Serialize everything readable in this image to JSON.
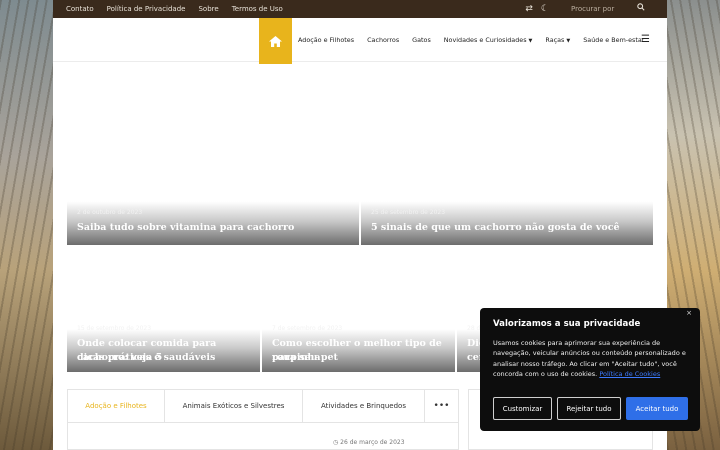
{
  "topbar": {
    "links": [
      "Contato",
      "Política de Privacidade",
      "Sobre",
      "Termos de Uso"
    ],
    "search_placeholder": "Procurar por",
    "icons": [
      "shuffle-icon",
      "moon-icon",
      "search-icon"
    ]
  },
  "nav": {
    "home_icon": "home-icon",
    "items": [
      {
        "label": "Adoção e Filhotes",
        "dropdown": false
      },
      {
        "label": "Cachorros",
        "dropdown": false
      },
      {
        "label": "Gatos",
        "dropdown": false
      },
      {
        "label": "Novidades e Curiosidades",
        "dropdown": true
      },
      {
        "label": "Raças",
        "dropdown": true
      },
      {
        "label": "Saúde e Bem-estar",
        "dropdown": false
      }
    ],
    "menu_icon": "hamburger-icon"
  },
  "posts": [
    {
      "date": "2 de outubro de 2023",
      "title": "Saiba tudo sobre vitamina para cachorro"
    },
    {
      "date": "25 de setembro de 2023",
      "title": "5 sinais de que um cachorro não gosta de você"
    },
    {
      "date": "15 de setembro de 2023",
      "title_line1": "Onde colocar comida para cachorro: veja 5",
      "title_line2": "dicas práticas e saudáveis"
    },
    {
      "date": "7 de setembro de 2023",
      "title_line1": "Como escolher o melhor tipo de roupinha",
      "title_line2": "para seu pet"
    },
    {
      "date": "28 d",
      "title_line1": "Dic",
      "title_line2": "cer"
    }
  ],
  "tabs": {
    "items": [
      "Adoção e Filhotes",
      "Animais Exóticos e Silvestres",
      "Atividades e Brinquedos"
    ],
    "more_label": "•••",
    "active_index": 0
  },
  "panel": {
    "date": "26 de março de 2023"
  },
  "cookie": {
    "title": "Valorizamos a sua privacidade",
    "text": "Usamos cookies para aprimorar sua experiência de navegação, veicular anúncios ou conteúdo personalizado e analisar nosso tráfego. Ao clicar em \"Aceitar tudo\", você concorda com o uso de cookies.",
    "link": "Política de Cookies",
    "close": "×",
    "buttons": {
      "customize": "Customizar",
      "reject": "Rejeitar tudo",
      "accept": "Aceitar tudo"
    }
  },
  "colors": {
    "accent": "#e8b41c",
    "topbar": "#3a2a1c",
    "cookie_bg": "#0d0d0d",
    "primary_button": "#2f6fe8"
  }
}
